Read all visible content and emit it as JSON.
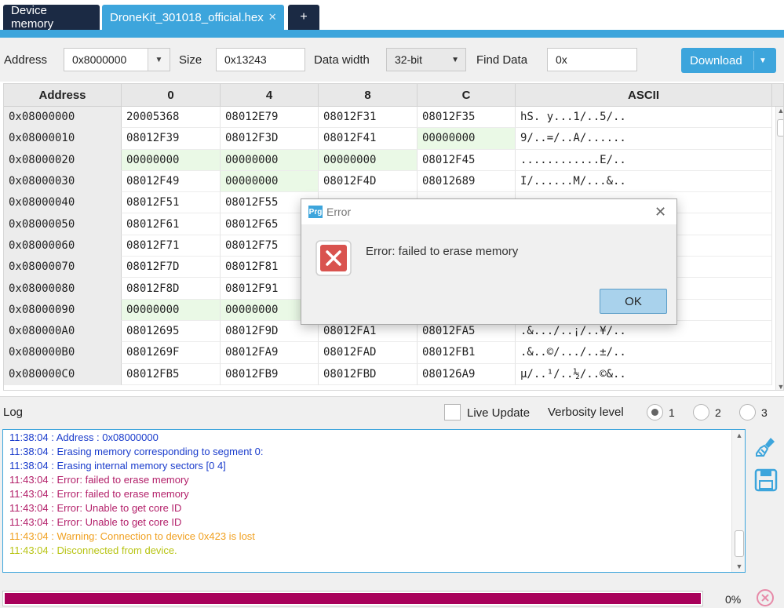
{
  "tabs": {
    "device_memory": "Device memory",
    "file": "DroneKit_301018_official.hex",
    "file_close": "✕",
    "add": "+"
  },
  "toolbar": {
    "address_label": "Address",
    "address_value": "0x8000000",
    "size_label": "Size",
    "size_value": "0x13243",
    "data_width_label": "Data width",
    "data_width_value": "32-bit",
    "find_label": "Find Data",
    "find_value": "0x",
    "download_label": "Download"
  },
  "table": {
    "headers": [
      "Address",
      "0",
      "4",
      "8",
      "C",
      "ASCII"
    ],
    "rows": [
      [
        "0x08000000",
        "20005368",
        "08012E79",
        "08012F31",
        "08012F35",
        "hS. y...1/..5/.."
      ],
      [
        "0x08000010",
        "08012F39",
        "08012F3D",
        "08012F41",
        "00000000",
        "9/..=/..A/......"
      ],
      [
        "0x08000020",
        "00000000",
        "00000000",
        "00000000",
        "08012F45",
        "............E/.."
      ],
      [
        "0x08000030",
        "08012F49",
        "00000000",
        "08012F4D",
        "08012689",
        "I/......M/...&.."
      ],
      [
        "0x08000040",
        "08012F51",
        "08012F55",
        "",
        "",
        ""
      ],
      [
        "0x08000050",
        "08012F61",
        "08012F65",
        "",
        "",
        ""
      ],
      [
        "0x08000060",
        "08012F71",
        "08012F75",
        "",
        "",
        ""
      ],
      [
        "0x08000070",
        "08012F7D",
        "08012F81",
        "",
        "",
        ""
      ],
      [
        "0x08000080",
        "08012F8D",
        "08012F91",
        "",
        "",
        ""
      ],
      [
        "0x08000090",
        "00000000",
        "00000000",
        "",
        "",
        ""
      ],
      [
        "0x080000A0",
        "08012695",
        "08012F9D",
        "08012FA1",
        "08012FA5",
        ".&.../..¡/..¥/.."
      ],
      [
        "0x080000B0",
        "0801269F",
        "08012FA9",
        "08012FAD",
        "08012FB1",
        ".&..©/.../..±/.."
      ],
      [
        "0x080000C0",
        "08012FB5",
        "08012FB9",
        "08012FBD",
        "080126A9",
        "µ/..¹/..½/..©&.."
      ]
    ]
  },
  "log": {
    "title": "Log",
    "live_update_label": "Live Update",
    "verbosity_label": "Verbosity level",
    "levels": [
      "1",
      "2",
      "3"
    ],
    "selected_level": "1",
    "lines": [
      {
        "text": "11:38:04 :   Address      : 0x08000000",
        "color": "#1a3ccc"
      },
      {
        "text": "11:38:04 : Erasing memory corresponding to segment 0:",
        "color": "#1a3ccc"
      },
      {
        "text": "11:38:04 : Erasing internal memory sectors [0 4]",
        "color": "#1a3ccc"
      },
      {
        "text": "11:43:04 : Error: failed to erase memory",
        "color": "#b3206a"
      },
      {
        "text": "11:43:04 : Error: failed to erase memory",
        "color": "#b3206a"
      },
      {
        "text": "11:43:04 : Error: Unable to get core ID",
        "color": "#b3206a"
      },
      {
        "text": "11:43:04 : Error: Unable to get core ID",
        "color": "#b3206a"
      },
      {
        "text": "11:43:04 : Warning: Connection to device 0x423 is lost",
        "color": "#f0a020"
      },
      {
        "text": "11:43:04 : Disconnected from device.",
        "color": "#b8c414"
      }
    ]
  },
  "progress": {
    "percent_label": "0%",
    "fill_fraction": 1.0,
    "bar_color": "#a8005a"
  },
  "dialog": {
    "logo_text": "Prg",
    "title": "Error",
    "message": "Error: failed to erase memory",
    "ok_label": "OK"
  },
  "colors": {
    "accent": "#3da5dc",
    "dark_tab": "#1b2a44",
    "zero_highlight": "#eaf9e6",
    "error_icon": "#d9534f"
  }
}
